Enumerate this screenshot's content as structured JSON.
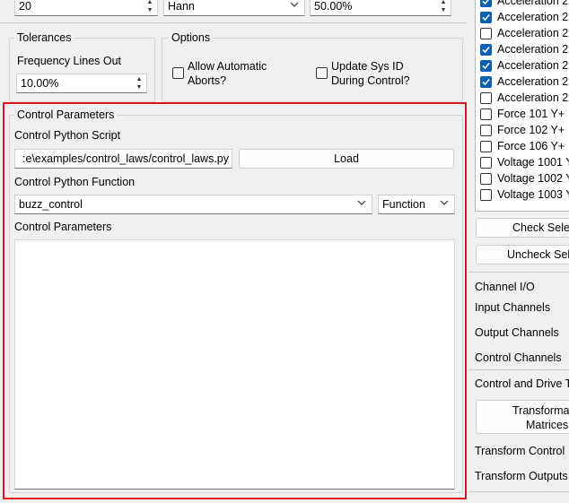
{
  "top_row": {
    "frame_count_value": "20",
    "window_value": "Hann",
    "overlap_value": "50.00%"
  },
  "tolerances": {
    "title": "Tolerances",
    "frequency_lines_label": "Frequency Lines Out",
    "frequency_lines_value": "10.00%"
  },
  "options": {
    "title": "Options",
    "allow_aborts_label_1": "Allow Automatic",
    "allow_aborts_label_2": "Aborts?",
    "allow_aborts_checked": false,
    "update_sysid_label_1": "Update Sys ID",
    "update_sysid_label_2": "During Control?",
    "update_sysid_checked": false
  },
  "control_parameters": {
    "title": "Control Parameters",
    "script_label": "Control Python Script",
    "script_path": ":e\\examples/control_laws/control_laws.py",
    "load_button": "Load",
    "function_label": "Control Python Function",
    "function_value": "buzz_control",
    "function_type_value": "Function",
    "parameters_label": "Control Parameters",
    "parameters_text": ""
  },
  "channels": {
    "items": [
      {
        "label": "Acceleration 2",
        "checked": true
      },
      {
        "label": "Acceleration 2",
        "checked": true
      },
      {
        "label": "Acceleration 2",
        "checked": false
      },
      {
        "label": "Acceleration 2",
        "checked": true
      },
      {
        "label": "Acceleration 2",
        "checked": true
      },
      {
        "label": "Acceleration 2",
        "checked": true
      },
      {
        "label": "Acceleration 2",
        "checked": false
      },
      {
        "label": "Force 101 Y+",
        "checked": false
      },
      {
        "label": "Force 102 Y+",
        "checked": false
      },
      {
        "label": "Force 106 Y+",
        "checked": false
      },
      {
        "label": "Voltage 1001 Y",
        "checked": false
      },
      {
        "label": "Voltage 1002 Y",
        "checked": false
      },
      {
        "label": "Voltage 1003 Y",
        "checked": false
      }
    ],
    "check_selected_button": "Check Sele",
    "uncheck_selected_button": "Uncheck Sel"
  },
  "channel_io": {
    "title": "Channel I/O",
    "input_channels": "Input Channels",
    "output_channels": "Output Channels",
    "control_channels": "Control Channels"
  },
  "control_drive": {
    "title": "Control and Drive T",
    "transformation_button_1": "Transforma",
    "transformation_button_2": "Matrices",
    "transform_control": "Transform Control",
    "transform_outputs": "Transform Outputs"
  },
  "colors": {
    "highlight_border": "#e0141e",
    "checkbox_checked": "#0a5fb4",
    "window_bg": "#f0f0f0"
  }
}
